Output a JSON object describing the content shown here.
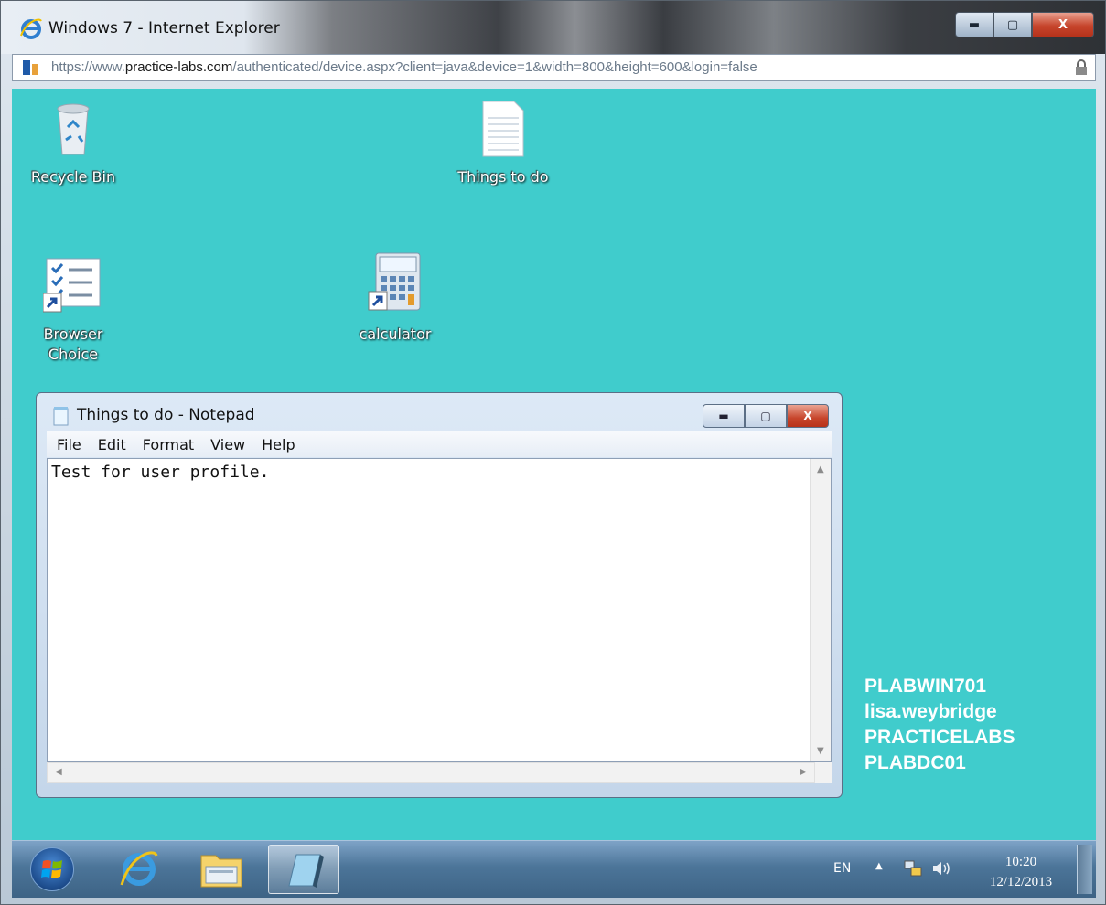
{
  "browser": {
    "title": "Windows 7 - Internet Explorer",
    "url_scheme": "https://www.",
    "url_host": "practice-labs.com",
    "url_path": "/authenticated/device.aspx?client=java&device=1&width=800&height=600&login=false"
  },
  "desktop": {
    "background": "#40cccc",
    "icons": [
      {
        "label": "Recycle Bin",
        "icon": "recycle-bin-icon"
      },
      {
        "label": "Things to do",
        "icon": "text-file-icon"
      },
      {
        "label": "Browser Choice",
        "label_line1": "Browser",
        "label_line2": "Choice",
        "icon": "browser-choice-icon"
      },
      {
        "label": "calculator",
        "icon": "calculator-icon"
      }
    ]
  },
  "notepad": {
    "title": "Things to do - Notepad",
    "menu": [
      "File",
      "Edit",
      "Format",
      "View",
      "Help"
    ],
    "content": "Test for user profile."
  },
  "bginfo": {
    "host": "PLABWIN701",
    "user": "lisa.weybridge",
    "domain": "PRACTICELABS",
    "dc": "PLABDC01"
  },
  "taskbar": {
    "language": "EN",
    "time": "10:20",
    "date": "12/12/2013"
  }
}
